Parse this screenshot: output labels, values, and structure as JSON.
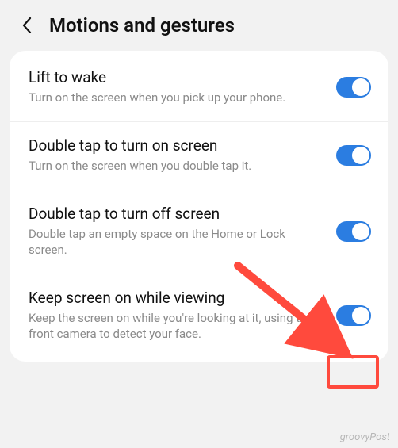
{
  "header": {
    "title": "Motions and gestures"
  },
  "settings": [
    {
      "title": "Lift to wake",
      "desc": "Turn on the screen when you pick up your phone.",
      "on": true
    },
    {
      "title": "Double tap to turn on screen",
      "desc": "Turn on the screen when you double tap it.",
      "on": true
    },
    {
      "title": "Double tap to turn off screen",
      "desc": "Double tap an empty space on the Home or Lock screen.",
      "on": true
    },
    {
      "title": "Keep screen on while viewing",
      "desc": "Keep the screen on while you're looking at it, using the front camera to detect your face.",
      "on": true
    }
  ],
  "annotation": {
    "highlight_color": "#ff4a3d",
    "arrow_color": "#ff4a3d"
  },
  "watermark": "groovyPost"
}
